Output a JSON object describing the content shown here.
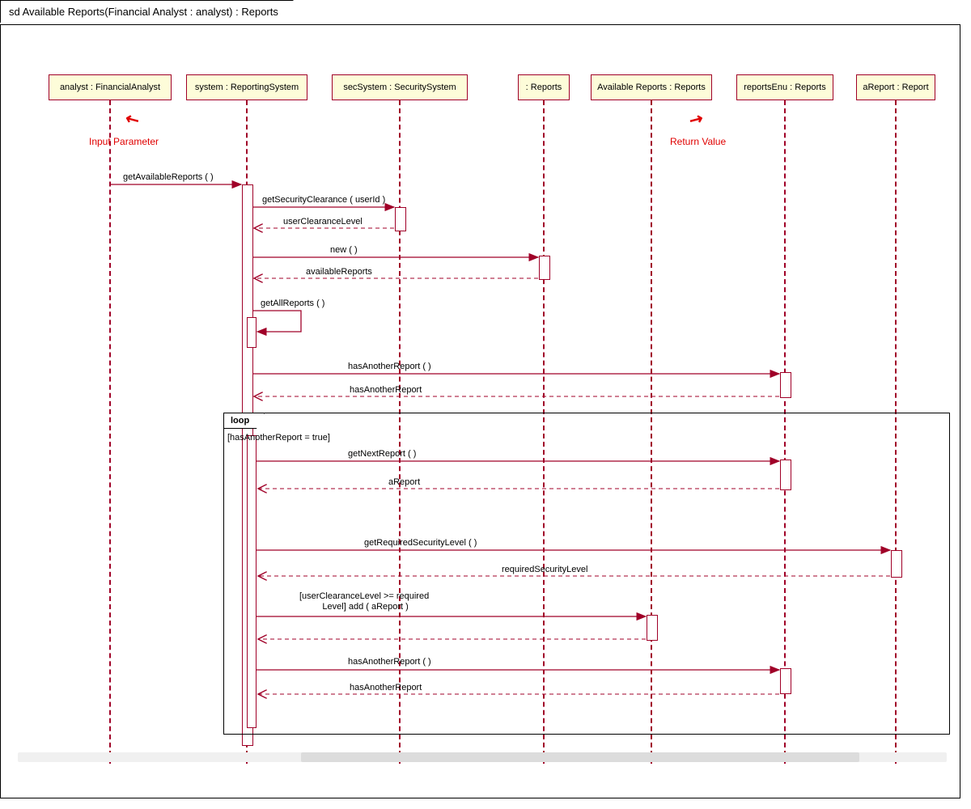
{
  "frame_title": "sd Available Reports(Financial Analyst : analyst) : Reports",
  "lifelines": [
    {
      "label": "analyst : FinancialAnalyst"
    },
    {
      "label": "system : ReportingSystem"
    },
    {
      "label": "secSystem : SecuritySystem"
    },
    {
      "label": ": Reports"
    },
    {
      "label": "Available Reports : Reports"
    },
    {
      "label": "reportsEnu : Reports"
    },
    {
      "label": "aReport : Report"
    }
  ],
  "annotations": {
    "input": "Input Parameter",
    "return": "Return Value"
  },
  "messages": {
    "m1": "getAvailableReports (  )",
    "m2": "getSecurityClearance ( userId )",
    "m2r": "userClearanceLevel",
    "m3": "new (  )",
    "m3r": "availableReports",
    "m4": "getAllReports (  )",
    "m5": "hasAnotherReport (  )",
    "m5r": "hasAnotherReport",
    "m6": "getNextReport (  )",
    "m6r": "aReport",
    "m7": "getRequiredSecurityLevel (  )",
    "m7r": "requiredSecurityLevel",
    "m8": "[userClearanceLevel >= required\n Level] add ( aReport )",
    "m9": "hasAnotherReport (  )",
    "m9r": "hasAnotherReport"
  },
  "loop": {
    "label": "loop",
    "guard": "[hasAnotherReport = true]"
  }
}
